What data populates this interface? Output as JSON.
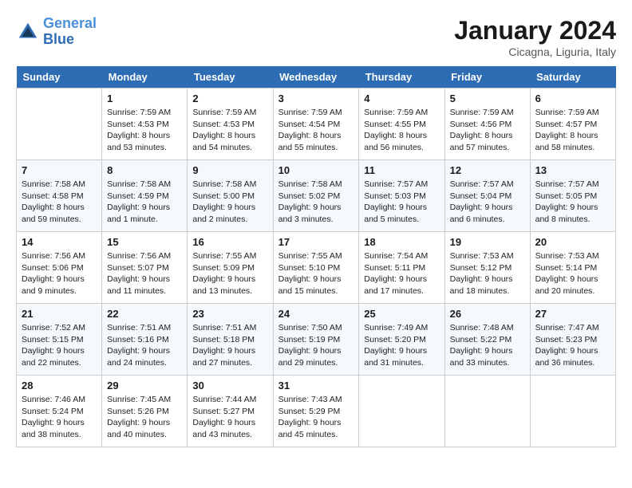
{
  "header": {
    "logo_line1": "General",
    "logo_line2": "Blue",
    "month": "January 2024",
    "location": "Cicagna, Liguria, Italy"
  },
  "columns": [
    "Sunday",
    "Monday",
    "Tuesday",
    "Wednesday",
    "Thursday",
    "Friday",
    "Saturday"
  ],
  "weeks": [
    [
      {
        "day": "",
        "sunrise": "",
        "sunset": "",
        "daylight": ""
      },
      {
        "day": "1",
        "sunrise": "Sunrise: 7:59 AM",
        "sunset": "Sunset: 4:53 PM",
        "daylight": "Daylight: 8 hours and 53 minutes."
      },
      {
        "day": "2",
        "sunrise": "Sunrise: 7:59 AM",
        "sunset": "Sunset: 4:53 PM",
        "daylight": "Daylight: 8 hours and 54 minutes."
      },
      {
        "day": "3",
        "sunrise": "Sunrise: 7:59 AM",
        "sunset": "Sunset: 4:54 PM",
        "daylight": "Daylight: 8 hours and 55 minutes."
      },
      {
        "day": "4",
        "sunrise": "Sunrise: 7:59 AM",
        "sunset": "Sunset: 4:55 PM",
        "daylight": "Daylight: 8 hours and 56 minutes."
      },
      {
        "day": "5",
        "sunrise": "Sunrise: 7:59 AM",
        "sunset": "Sunset: 4:56 PM",
        "daylight": "Daylight: 8 hours and 57 minutes."
      },
      {
        "day": "6",
        "sunrise": "Sunrise: 7:59 AM",
        "sunset": "Sunset: 4:57 PM",
        "daylight": "Daylight: 8 hours and 58 minutes."
      }
    ],
    [
      {
        "day": "7",
        "sunrise": "Sunrise: 7:58 AM",
        "sunset": "Sunset: 4:58 PM",
        "daylight": "Daylight: 8 hours and 59 minutes."
      },
      {
        "day": "8",
        "sunrise": "Sunrise: 7:58 AM",
        "sunset": "Sunset: 4:59 PM",
        "daylight": "Daylight: 9 hours and 1 minute."
      },
      {
        "day": "9",
        "sunrise": "Sunrise: 7:58 AM",
        "sunset": "Sunset: 5:00 PM",
        "daylight": "Daylight: 9 hours and 2 minutes."
      },
      {
        "day": "10",
        "sunrise": "Sunrise: 7:58 AM",
        "sunset": "Sunset: 5:02 PM",
        "daylight": "Daylight: 9 hours and 3 minutes."
      },
      {
        "day": "11",
        "sunrise": "Sunrise: 7:57 AM",
        "sunset": "Sunset: 5:03 PM",
        "daylight": "Daylight: 9 hours and 5 minutes."
      },
      {
        "day": "12",
        "sunrise": "Sunrise: 7:57 AM",
        "sunset": "Sunset: 5:04 PM",
        "daylight": "Daylight: 9 hours and 6 minutes."
      },
      {
        "day": "13",
        "sunrise": "Sunrise: 7:57 AM",
        "sunset": "Sunset: 5:05 PM",
        "daylight": "Daylight: 9 hours and 8 minutes."
      }
    ],
    [
      {
        "day": "14",
        "sunrise": "Sunrise: 7:56 AM",
        "sunset": "Sunset: 5:06 PM",
        "daylight": "Daylight: 9 hours and 9 minutes."
      },
      {
        "day": "15",
        "sunrise": "Sunrise: 7:56 AM",
        "sunset": "Sunset: 5:07 PM",
        "daylight": "Daylight: 9 hours and 11 minutes."
      },
      {
        "day": "16",
        "sunrise": "Sunrise: 7:55 AM",
        "sunset": "Sunset: 5:09 PM",
        "daylight": "Daylight: 9 hours and 13 minutes."
      },
      {
        "day": "17",
        "sunrise": "Sunrise: 7:55 AM",
        "sunset": "Sunset: 5:10 PM",
        "daylight": "Daylight: 9 hours and 15 minutes."
      },
      {
        "day": "18",
        "sunrise": "Sunrise: 7:54 AM",
        "sunset": "Sunset: 5:11 PM",
        "daylight": "Daylight: 9 hours and 17 minutes."
      },
      {
        "day": "19",
        "sunrise": "Sunrise: 7:53 AM",
        "sunset": "Sunset: 5:12 PM",
        "daylight": "Daylight: 9 hours and 18 minutes."
      },
      {
        "day": "20",
        "sunrise": "Sunrise: 7:53 AM",
        "sunset": "Sunset: 5:14 PM",
        "daylight": "Daylight: 9 hours and 20 minutes."
      }
    ],
    [
      {
        "day": "21",
        "sunrise": "Sunrise: 7:52 AM",
        "sunset": "Sunset: 5:15 PM",
        "daylight": "Daylight: 9 hours and 22 minutes."
      },
      {
        "day": "22",
        "sunrise": "Sunrise: 7:51 AM",
        "sunset": "Sunset: 5:16 PM",
        "daylight": "Daylight: 9 hours and 24 minutes."
      },
      {
        "day": "23",
        "sunrise": "Sunrise: 7:51 AM",
        "sunset": "Sunset: 5:18 PM",
        "daylight": "Daylight: 9 hours and 27 minutes."
      },
      {
        "day": "24",
        "sunrise": "Sunrise: 7:50 AM",
        "sunset": "Sunset: 5:19 PM",
        "daylight": "Daylight: 9 hours and 29 minutes."
      },
      {
        "day": "25",
        "sunrise": "Sunrise: 7:49 AM",
        "sunset": "Sunset: 5:20 PM",
        "daylight": "Daylight: 9 hours and 31 minutes."
      },
      {
        "day": "26",
        "sunrise": "Sunrise: 7:48 AM",
        "sunset": "Sunset: 5:22 PM",
        "daylight": "Daylight: 9 hours and 33 minutes."
      },
      {
        "day": "27",
        "sunrise": "Sunrise: 7:47 AM",
        "sunset": "Sunset: 5:23 PM",
        "daylight": "Daylight: 9 hours and 36 minutes."
      }
    ],
    [
      {
        "day": "28",
        "sunrise": "Sunrise: 7:46 AM",
        "sunset": "Sunset: 5:24 PM",
        "daylight": "Daylight: 9 hours and 38 minutes."
      },
      {
        "day": "29",
        "sunrise": "Sunrise: 7:45 AM",
        "sunset": "Sunset: 5:26 PM",
        "daylight": "Daylight: 9 hours and 40 minutes."
      },
      {
        "day": "30",
        "sunrise": "Sunrise: 7:44 AM",
        "sunset": "Sunset: 5:27 PM",
        "daylight": "Daylight: 9 hours and 43 minutes."
      },
      {
        "day": "31",
        "sunrise": "Sunrise: 7:43 AM",
        "sunset": "Sunset: 5:29 PM",
        "daylight": "Daylight: 9 hours and 45 minutes."
      },
      {
        "day": "",
        "sunrise": "",
        "sunset": "",
        "daylight": ""
      },
      {
        "day": "",
        "sunrise": "",
        "sunset": "",
        "daylight": ""
      },
      {
        "day": "",
        "sunrise": "",
        "sunset": "",
        "daylight": ""
      }
    ]
  ]
}
